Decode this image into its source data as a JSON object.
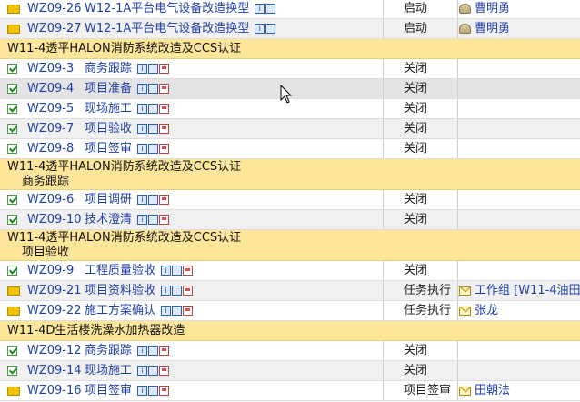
{
  "rows": [
    {
      "type": "task",
      "id": "WZ09-26",
      "name": "W12-1A平台电气设备改造换型",
      "status": "启动",
      "assignee": "曹明勇",
      "icon": "folder",
      "tools": 2,
      "assignee_icon": "person"
    },
    {
      "type": "task",
      "id": "WZ09-27",
      "name": "W12-1A平台电气设备改造换型",
      "status": "启动",
      "assignee": "曹明勇",
      "icon": "folder",
      "tools": 2,
      "assignee_icon": "person"
    },
    {
      "type": "group",
      "line1": "W11-4透平HALON消防系统改造及CCS认证",
      "line2": ""
    },
    {
      "type": "task",
      "id": "WZ09-3",
      "name": "商务跟踪",
      "status": "关闭",
      "assignee": "",
      "icon": "check",
      "tools": 3
    },
    {
      "type": "task",
      "id": "WZ09-4",
      "name": "项目准备",
      "status": "关闭",
      "assignee": "",
      "icon": "check",
      "tools": 3
    },
    {
      "type": "task",
      "id": "WZ09-5",
      "name": "现场施工",
      "status": "关闭",
      "assignee": "",
      "icon": "check",
      "tools": 3
    },
    {
      "type": "task",
      "id": "WZ09-7",
      "name": "项目验收",
      "status": "关闭",
      "assignee": "",
      "icon": "check",
      "tools": 3
    },
    {
      "type": "task",
      "id": "WZ09-8",
      "name": "项目签审",
      "status": "关闭",
      "assignee": "",
      "icon": "check",
      "tools": 3
    },
    {
      "type": "group",
      "line1": "W11-4透平HALON消防系统改造及CCS认证",
      "line2": "商务跟踪"
    },
    {
      "type": "task",
      "id": "WZ09-6",
      "name": "项目调研",
      "status": "关闭",
      "assignee": "",
      "icon": "check",
      "tools": 3
    },
    {
      "type": "task",
      "id": "WZ09-10",
      "name": "技术澄清",
      "status": "关闭",
      "assignee": "",
      "icon": "check",
      "tools": 3
    },
    {
      "type": "group",
      "line1": "W11-4透平HALON消防系统改造及CCS认证",
      "line2": "项目验收"
    },
    {
      "type": "task",
      "id": "WZ09-9",
      "name": "工程质量验收",
      "status": "关闭",
      "assignee": "",
      "icon": "check",
      "tools": 3
    },
    {
      "type": "task",
      "id": "WZ09-21",
      "name": "项目资料验收",
      "status": "任务执行",
      "assignee": "工作组 [W11-4油田",
      "icon": "folder",
      "tools": 3,
      "assignee_icon": "mail"
    },
    {
      "type": "task",
      "id": "WZ09-22",
      "name": "施工方案确认",
      "status": "任务执行",
      "assignee": "张龙",
      "icon": "folder",
      "tools": 3,
      "assignee_icon": "mail"
    },
    {
      "type": "group",
      "line1": "W11-4D生活楼洗澡水加热器改造",
      "line2": ""
    },
    {
      "type": "task",
      "id": "WZ09-12",
      "name": "商务跟踪",
      "status": "关闭",
      "assignee": "",
      "icon": "check",
      "tools": 3
    },
    {
      "type": "task",
      "id": "WZ09-14",
      "name": "现场施工",
      "status": "关闭",
      "assignee": "",
      "icon": "check",
      "tools": 3
    },
    {
      "type": "task",
      "id": "WZ09-16",
      "name": "项目签审",
      "status": "项目签审",
      "assignee": "田朝法",
      "icon": "folder",
      "tools": 3,
      "assignee_icon": "mail"
    }
  ]
}
